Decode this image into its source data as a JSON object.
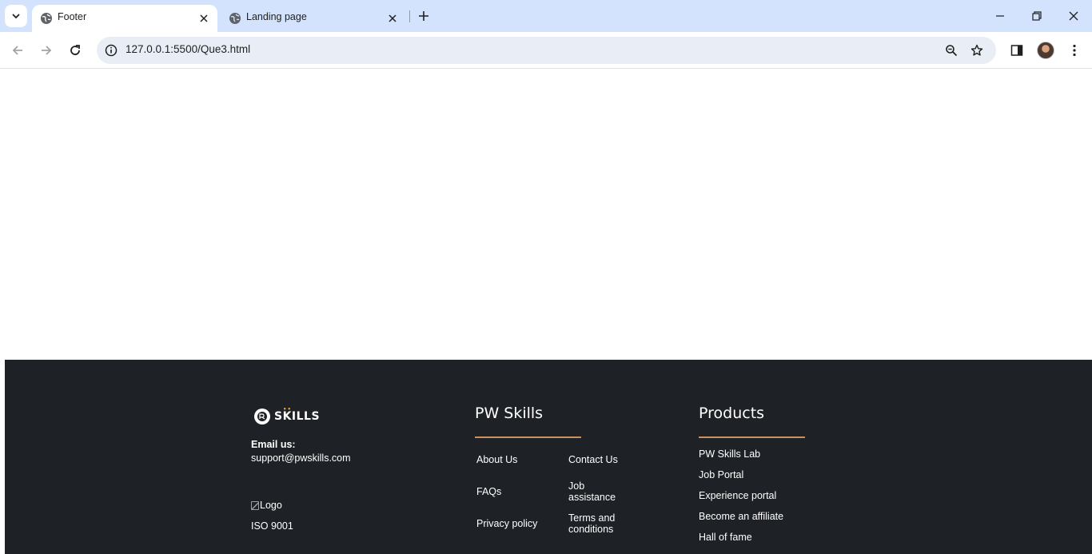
{
  "browser": {
    "tabs": [
      {
        "title": "Footer",
        "active": true
      },
      {
        "title": "Landing page",
        "active": false
      }
    ],
    "address": "127.0.0.1:5500/Que3.html"
  },
  "footer": {
    "brand": {
      "logo_text": "SKILLS",
      "email_label": "Email us:",
      "email_value": "support@pwskills.com",
      "broken_image_alt": "Logo",
      "certification": "ISO 9001"
    },
    "pw_skills": {
      "heading": "PW Skills",
      "links": [
        "About Us",
        "Contact Us",
        "FAQs",
        "Job assistance",
        "Privacy policy",
        "Terms and conditions"
      ]
    },
    "products": {
      "heading": "Products",
      "links": [
        "PW Skills Lab",
        "Job Portal",
        "Experience portal",
        "Become an affiliate",
        "Hall of fame"
      ]
    }
  },
  "colors": {
    "tabstrip": "#d3e3fd",
    "footer_bg": "#1e2125",
    "heading_rule": "#c8915f"
  }
}
